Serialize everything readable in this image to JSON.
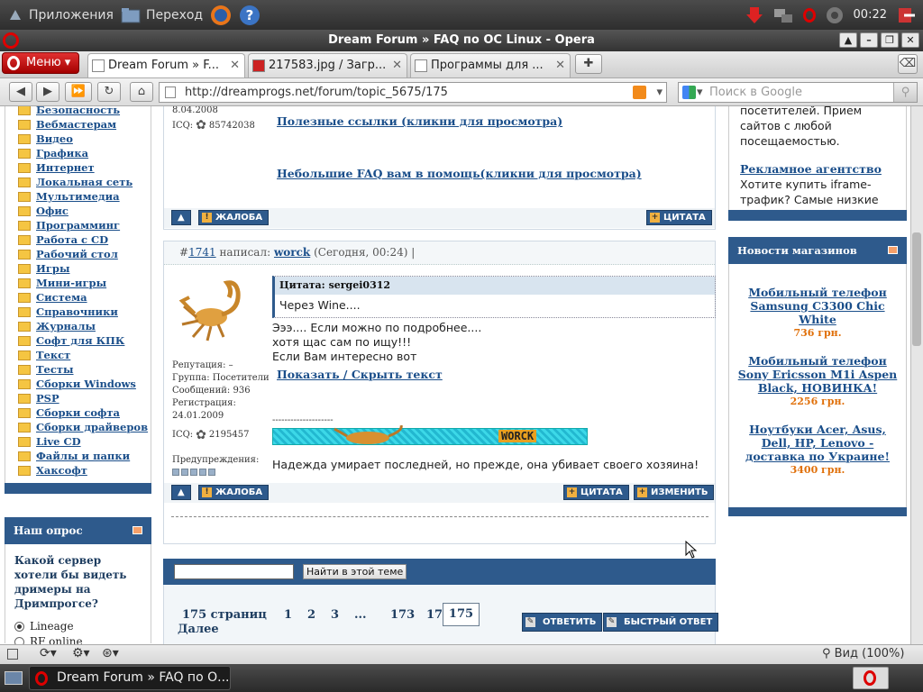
{
  "top_panel": {
    "apps": "Приложения",
    "places": "Переход",
    "clock": "00:22"
  },
  "window": {
    "title": "Dream Forum » FAQ по ОС Linux - Opera"
  },
  "tabs": {
    "menu": "Меню",
    "items": [
      {
        "label": "Dream Forum » F..."
      },
      {
        "label": "217583.jpg / Загр..."
      },
      {
        "label": "Программы для ..."
      }
    ]
  },
  "nav": {
    "url": "http://dreamprogs.net/forum/topic_5675/175",
    "search_placeholder": "Поиск в Google"
  },
  "left": {
    "categories": [
      "Безопасность",
      "Вебмастерам",
      "Видео",
      "Графика",
      "Интернет",
      "Локальная сеть",
      "Мультимедиа",
      "Офис",
      "Программинг",
      "Работа с CD",
      "Рабочий стол",
      "Игры",
      "Мини-игры",
      "Система",
      "Справочники",
      "Журналы",
      "Софт для КПК",
      "Текст",
      "Тесты",
      "Сборки Windows",
      "PSP",
      "Сборки софта",
      "Сборки драйверов",
      "Live CD",
      "Файлы и папки",
      "Хаксофт"
    ],
    "poll": {
      "title": "Наш опрос",
      "question": "Какой сервер хотели бы видеть дримеры на Дримпрогсе?",
      "options": [
        "Lineage",
        "RF online"
      ],
      "selected": "Lineage"
    }
  },
  "post1": {
    "date": "8.04.2008",
    "icq_label": "ICQ:",
    "icq": "85742038",
    "link1": "Полезные ссылки (кликни для просмотра)",
    "link2": "Небольшие FAQ вам в помощь(кликни для просмотра)",
    "complain": "ЖАЛОБА",
    "quote": "ЦИТАТА"
  },
  "post2": {
    "num_prefix": "#",
    "num": "1741",
    "wrote": "написал:",
    "author": "worck",
    "time": "(Сегодня, 00:24) |",
    "rep": "Репутация: –",
    "group": "Группа: Посетители",
    "msgs": "Сообщений: 936",
    "reg_label": "Регистрация:",
    "reg": "24.01.2009",
    "icq_label": "ICQ:",
    "icq": "2195457",
    "warn": "Предупреждения:",
    "quote_head": "Цитата: sergei0312",
    "quote_text": "Через Wine....",
    "line1": "Эээ.... Если можно по подробнее....",
    "line2": "хотя щас сам по ищу!!!",
    "line3": "Если Вам интересно вот",
    "spoiler": "Показать / Скрыть текст",
    "separator": "--------------------",
    "banner": "WORCK",
    "signature": "Надежда умирает последней, но прежде, она убивает своего хозяина!",
    "complain": "ЖАЛОБА",
    "quote": "ЦИТАТА",
    "edit": "ИЗМЕНИТЬ"
  },
  "topic_search": {
    "button": "Найти в этой теме",
    "value": ""
  },
  "pager": {
    "label": "175 страниц",
    "pages": [
      "1",
      "2",
      "3",
      "...",
      "173",
      "174"
    ],
    "current": "175",
    "next": "Далее",
    "reply": "ОТВЕТИТЬ",
    "fast_reply": "БЫСТРЫЙ ОТВЕТ"
  },
  "right": {
    "ad_text1": "посетителей. Прием",
    "ad_text2": "сайтов с любой",
    "ad_text3": "посещаемостью.",
    "ad_link": "Рекламное агентство",
    "ad_text4": "Хотите купить iframe-",
    "ad_text5": "трафик? Самые низкие",
    "shop_title": "Новости магазинов",
    "products": [
      {
        "name": "Мобильный телефон Samsung C3300 Chic White",
        "price": "736 грн."
      },
      {
        "name": "Мобильный телефон Sony Ericsson M1i Aspen Black, НОВИНКА!",
        "price": "2256 грн."
      },
      {
        "name": "Ноутбуки Acer, Asus, Dell, HP, Lenovo - доставка по Украине!",
        "price": "3400 грн."
      }
    ]
  },
  "status": {
    "zoom": "Вид (100%)"
  },
  "taskbar": {
    "task": "Dream Forum » FAQ по О..."
  },
  "colors": {
    "forum_blue": "#2e5a8c",
    "opera_red": "#cc0000",
    "price_orange": "#e0700a"
  }
}
